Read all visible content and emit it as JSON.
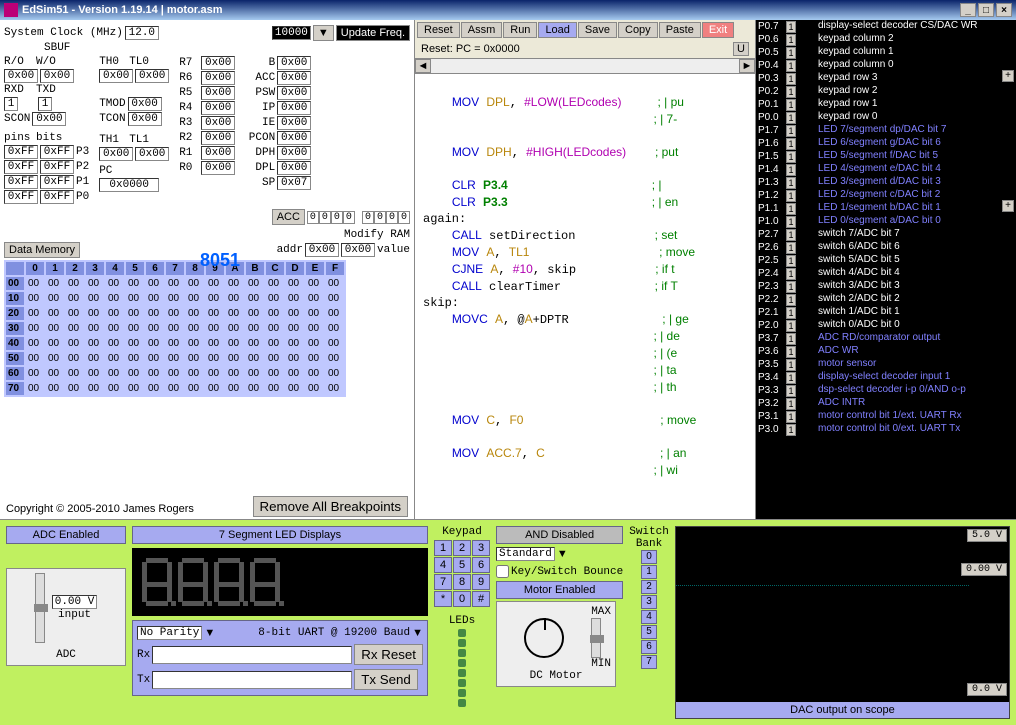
{
  "window": {
    "title": "EdSim51 - Version 1.19.14 | motor.asm",
    "min": "_",
    "max": "□",
    "close": "×"
  },
  "clock": {
    "label": "System Clock (MHz)",
    "value": "12.0",
    "freq": "10000",
    "updatebtn": "Update Freq.",
    "sbuf": "SBUF"
  },
  "regs": {
    "ro": "R/O",
    "wo": "W/O",
    "th0": "TH0",
    "tl0": "TL0",
    "rxd": "RXD",
    "txd": "TXD",
    "tmod": "TMOD",
    "tcon": "TCON",
    "scon": "SCON",
    "th1": "TH1",
    "tl1": "TL1",
    "pc": "PC",
    "pcval": "0x0000",
    "r7": "R7",
    "r6": "R6",
    "r5": "R5",
    "r4": "R4",
    "r3": "R3",
    "r2": "R2",
    "r1": "R1",
    "r0": "R0",
    "b": "B",
    "acc_l": "ACC",
    "psw": "PSW",
    "ip": "IP",
    "ie": "IE",
    "pcon": "PCON",
    "dph": "DPH",
    "dpl": "DPL",
    "sp": "SP",
    "spv": "0x07",
    "hex": "0x00",
    "hexFF": "0xFF",
    "one": "1",
    "pins": "pins",
    "bits": "bits",
    "p3": "P3",
    "p2": "P2",
    "p1": "P1",
    "p0": "P0",
    "chip": "8051",
    "acc": "ACC",
    "bit": "0",
    "modifyram": "Modify RAM",
    "addr": "addr",
    "addrv": "0x00",
    "valuev": "0x00",
    "value": "value",
    "datamem": "Data Memory"
  },
  "hexhdr": [
    "0",
    "1",
    "2",
    "3",
    "4",
    "5",
    "6",
    "7",
    "8",
    "9",
    "A",
    "B",
    "C",
    "D",
    "E",
    "F"
  ],
  "hexrows": [
    "00",
    "10",
    "20",
    "30",
    "40",
    "50",
    "60",
    "70"
  ],
  "copyright": "Copyright © 2005-2010 James Rogers",
  "rmvbrk": "Remove All Breakpoints",
  "toolbar": {
    "reset": "Reset",
    "assm": "Assm",
    "run": "Run",
    "load": "Load",
    "save": "Save",
    "copy": "Copy",
    "paste": "Paste",
    "exit": "Exit"
  },
  "resetline": "Reset: PC = 0x0000",
  "code_lines": [
    "",
    "    MOV DPL, #LOW(LEDcodes)     ; | pu",
    "                                ; | 7-",
    "",
    "    MOV DPH, #HIGH(LEDcodes)    ; put ",
    "",
    "    CLR P3.4                    ; |",
    "    CLR P3.3                    ; | en",
    "again:",
    "    CALL setDirection           ; set ",
    "    MOV A, TL1                  ; move",
    "    CJNE A, #10, skip           ; if t",
    "    CALL clearTimer             ; if T",
    "skip:",
    "    MOVC A, @A+DPTR             ; | ge",
    "                                ; | de",
    "                                ; | (e",
    "                                ; | ta",
    "                                ; | th",
    "",
    "    MOV C, F0                   ; move",
    "",
    "    MOV ACC.7, C                ; | an",
    "                                ; | wi"
  ],
  "pinrows": [
    {
      "p": "P0.7",
      "d": "display-select decoder CS/DAC WR",
      "c": "white"
    },
    {
      "p": "P0.6",
      "d": "keypad column 2",
      "c": "white"
    },
    {
      "p": "P0.5",
      "d": "keypad column 1",
      "c": "white"
    },
    {
      "p": "P0.4",
      "d": "keypad column 0",
      "c": "white"
    },
    {
      "p": "P0.3",
      "d": "keypad row 3",
      "c": "white"
    },
    {
      "p": "P0.2",
      "d": "keypad row 2",
      "c": "white"
    },
    {
      "p": "P0.1",
      "d": "keypad row 1",
      "c": "white"
    },
    {
      "p": "P0.0",
      "d": "keypad row 0",
      "c": "white"
    },
    {
      "p": "P1.7",
      "d": "LED 7/segment dp/DAC bit 7",
      "c": "blue"
    },
    {
      "p": "P1.6",
      "d": "LED 6/segment g/DAC bit 6",
      "c": "blue"
    },
    {
      "p": "P1.5",
      "d": "LED 5/segment f/DAC bit 5",
      "c": "blue"
    },
    {
      "p": "P1.4",
      "d": "LED 4/segment e/DAC bit 4",
      "c": "blue"
    },
    {
      "p": "P1.3",
      "d": "LED 3/segment d/DAC bit 3",
      "c": "blue"
    },
    {
      "p": "P1.2",
      "d": "LED 2/segment c/DAC bit 2",
      "c": "blue"
    },
    {
      "p": "P1.1",
      "d": "LED 1/segment b/DAC bit 1",
      "c": "blue"
    },
    {
      "p": "P1.0",
      "d": "LED 0/segment a/DAC bit 0",
      "c": "blue"
    },
    {
      "p": "P2.7",
      "d": "switch 7/ADC bit 7",
      "c": "white"
    },
    {
      "p": "P2.6",
      "d": "switch 6/ADC bit 6",
      "c": "white"
    },
    {
      "p": "P2.5",
      "d": "switch 5/ADC bit 5",
      "c": "white"
    },
    {
      "p": "P2.4",
      "d": "switch 4/ADC bit 4",
      "c": "white"
    },
    {
      "p": "P2.3",
      "d": "switch 3/ADC bit 3",
      "c": "white"
    },
    {
      "p": "P2.2",
      "d": "switch 2/ADC bit 2",
      "c": "white"
    },
    {
      "p": "P2.1",
      "d": "switch 1/ADC bit 1",
      "c": "white"
    },
    {
      "p": "P2.0",
      "d": "switch 0/ADC bit 0",
      "c": "white"
    },
    {
      "p": "P3.7",
      "d": "ADC RD/comparator output",
      "c": "blue"
    },
    {
      "p": "P3.6",
      "d": "ADC WR",
      "c": "blue"
    },
    {
      "p": "P3.5",
      "d": "motor sensor",
      "c": "blue"
    },
    {
      "p": "P3.4",
      "d": "display-select decoder input 1",
      "c": "blue"
    },
    {
      "p": "P3.3",
      "d": "dsp-select decoder i-p 0/AND o-p",
      "c": "blue"
    },
    {
      "p": "P3.2",
      "d": "ADC INTR",
      "c": "blue"
    },
    {
      "p": "P3.1",
      "d": "motor control bit 1/ext. UART Rx",
      "c": "blue"
    },
    {
      "p": "P3.0",
      "d": "motor control bit 0/ext. UART Tx",
      "c": "blue"
    }
  ],
  "hw": {
    "sevenseg": "7 Segment LED Displays",
    "adcen": "ADC Enabled",
    "adcval": "0.00 V",
    "adcin": "input",
    "adc": "ADC",
    "keypad": "Keypad",
    "anddis": "AND Disabled",
    "standard": "Standard",
    "bounce": "Key/Switch Bounce",
    "motoren": "Motor Enabled",
    "max": "MAX",
    "min": "MIN",
    "dcmotor": "DC Motor",
    "switchbank": "Switch\nBank",
    "leds": "LEDs",
    "noparity": "No Parity",
    "uartcfg": "8-bit UART @ 19200 Baud",
    "rx": "Rx",
    "tx": "Tx",
    "rxreset": "Rx Reset",
    "txsend": "Tx Send",
    "v5": "5.0 V",
    "v0": "0.00 V",
    "v0b": "0.0 V",
    "dacout": "DAC output on scope"
  },
  "keys": [
    "1",
    "2",
    "3",
    "4",
    "5",
    "6",
    "7",
    "8",
    "9",
    "*",
    "0",
    "#"
  ],
  "switches": [
    "0",
    "1",
    "2",
    "3",
    "4",
    "5",
    "6",
    "7"
  ]
}
